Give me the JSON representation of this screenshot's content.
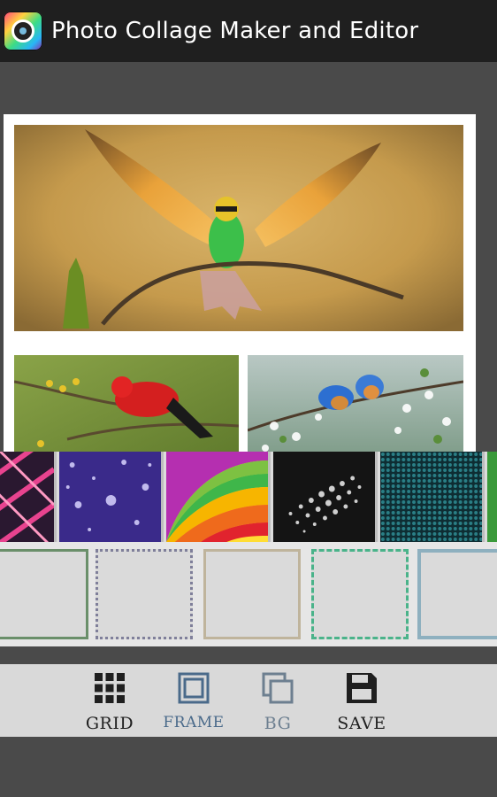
{
  "app": {
    "title": "Photo Collage Maker and Editor",
    "icon": "app-logo-icon"
  },
  "collage": {
    "photos": [
      {
        "name": "photo-main",
        "subject": "bird-with-spread-wings"
      },
      {
        "name": "photo-left",
        "subject": "red-bird-on-branch"
      },
      {
        "name": "photo-right",
        "subject": "bluebirds-on-blossom-branch"
      }
    ]
  },
  "backgrounds": [
    "pink-plaid",
    "purple-water-drops",
    "rainbow-stripes",
    "dark-halftone",
    "teal-mesh",
    "green-partial"
  ],
  "frames": [
    "green-border",
    "dotted-border",
    "beige-border",
    "dashed-green-border",
    "teal-border"
  ],
  "toolbar": {
    "grid_label": "GRID",
    "frame_label": "FRAME",
    "bg_label": "BG",
    "save_label": "SAVE",
    "icons": [
      "grid-icon",
      "frame-icon",
      "bg-icon",
      "save-icon"
    ],
    "colors": {
      "active": "#1f1f1f",
      "inactive": "#4a6a8a",
      "bg_inactive": "#6d7f90"
    }
  }
}
